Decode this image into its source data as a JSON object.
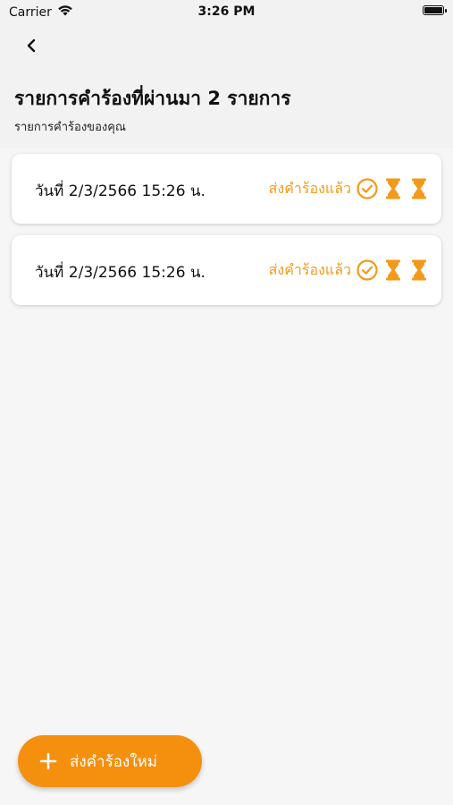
{
  "status_bar": {
    "carrier": "Carrier",
    "time": "3:26 PM"
  },
  "header": {
    "title": "รายการคำร้องที่ผ่านมา 2 รายการ",
    "subtitle": "รายการคำร้องของคุณ"
  },
  "requests": [
    {
      "date": "วันที่ 2/3/2566 15:26 น.",
      "status": "ส่งคำร้องแล้ว",
      "step_icons": [
        "check-circle-icon",
        "hourglass-icon",
        "hourglass-icon"
      ]
    },
    {
      "date": "วันที่ 2/3/2566 15:26 น.",
      "status": "ส่งคำร้องแล้ว",
      "step_icons": [
        "check-circle-icon",
        "hourglass-icon",
        "hourglass-icon"
      ]
    }
  ],
  "fab": {
    "label": "ส่งคำร้องใหม่"
  },
  "colors": {
    "accent": "#f5900f",
    "status_text": "#f49a1b",
    "background": "#f6f6f6",
    "header_background": "#f2f2f2"
  }
}
